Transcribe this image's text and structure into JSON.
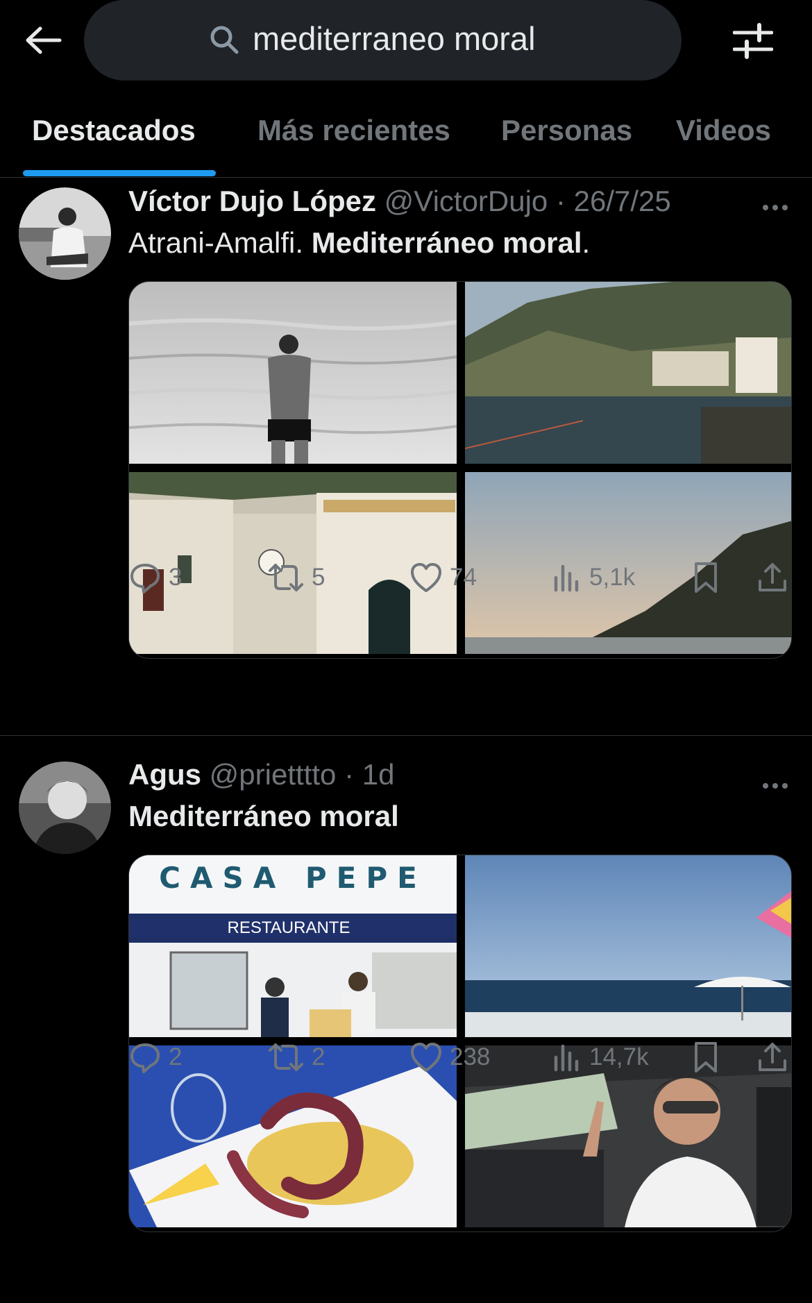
{
  "search": {
    "query": "mediterraneo moral"
  },
  "tabs": [
    {
      "label": "Destacados",
      "active": true
    },
    {
      "label": "Más recientes",
      "active": false
    },
    {
      "label": "Personas",
      "active": false
    },
    {
      "label": "Videos",
      "active": false
    }
  ],
  "colors": {
    "accent": "#1d9bf0",
    "background": "#000000",
    "muted": "#71767b",
    "text": "#e7e9ea",
    "divider": "#2f3336"
  },
  "tweets": [
    {
      "display_name": "Víctor Dujo López",
      "handle": "@VictorDujo",
      "separator": "·",
      "date": "26/7/25",
      "text_plain": "Atrani-Amalfi. ",
      "text_bold": "Mediterráneo moral",
      "text_tail": ".",
      "stats": {
        "replies": "3",
        "reposts": "5",
        "likes": "74",
        "views": "5,1k"
      }
    },
    {
      "display_name": "Agus",
      "handle": "@prietttto",
      "separator": "·",
      "date": "1d",
      "text_plain": "",
      "text_bold": "Mediterráneo moral",
      "text_tail": "",
      "media_texts": {
        "sign": "CASA  PEPE",
        "sub_sign": "RESTAURANTE"
      },
      "stats": {
        "replies": "2",
        "reposts": "2",
        "likes": "238",
        "views": "14,7k"
      }
    }
  ],
  "icons": [
    "back-arrow-icon",
    "search-icon",
    "filter-sliders-icon",
    "more-dots-icon",
    "reply-icon",
    "repost-icon",
    "like-icon",
    "views-icon",
    "bookmark-icon",
    "share-icon"
  ]
}
